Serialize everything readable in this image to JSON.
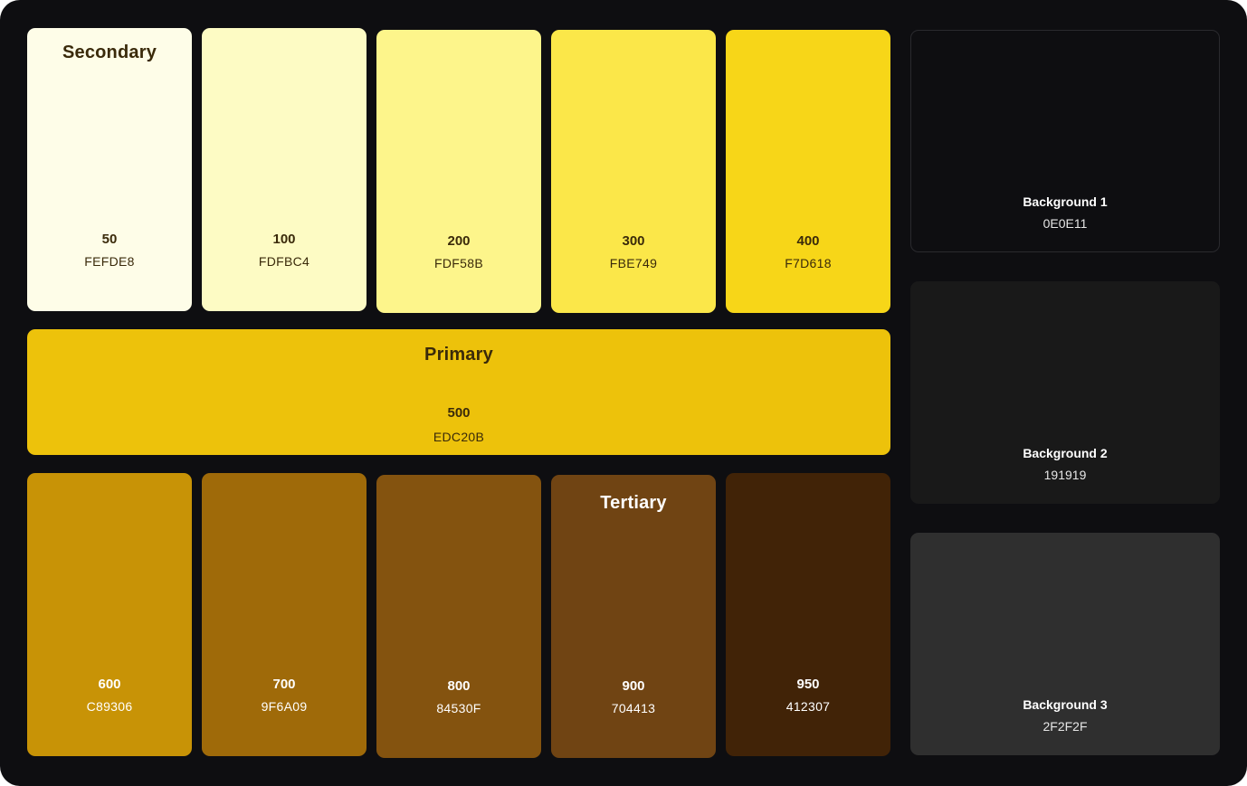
{
  "palette": {
    "secondary_title": "Secondary",
    "primary_title": "Primary",
    "tertiary_title": "Tertiary",
    "swatches": [
      {
        "shade": "50",
        "hex": "FEFDE8",
        "color": "#FEFDE8",
        "text_color": "#3a2a0a"
      },
      {
        "shade": "100",
        "hex": "FDFBC4",
        "color": "#FDFBC4",
        "text_color": "#3a2a0a"
      },
      {
        "shade": "200",
        "hex": "FDF58B",
        "color": "#FDF58B",
        "text_color": "#3a2a0a"
      },
      {
        "shade": "300",
        "hex": "FBE749",
        "color": "#FBE749",
        "text_color": "#3a2a0a"
      },
      {
        "shade": "400",
        "hex": "F7D618",
        "color": "#F7D618",
        "text_color": "#3a2a0a"
      },
      {
        "shade": "500",
        "hex": "EDC20B",
        "color": "#EDC20B",
        "text_color": "#3a2a0a"
      },
      {
        "shade": "600",
        "hex": "C89306",
        "color": "#C89306",
        "text_color": "#ffffff"
      },
      {
        "shade": "700",
        "hex": "9F6A09",
        "color": "#9F6A09",
        "text_color": "#ffffff"
      },
      {
        "shade": "800",
        "hex": "84530F",
        "color": "#84530F",
        "text_color": "#ffffff"
      },
      {
        "shade": "900",
        "hex": "704413",
        "color": "#704413",
        "text_color": "#ffffff"
      },
      {
        "shade": "950",
        "hex": "412307",
        "color": "#412307",
        "text_color": "#ffffff"
      }
    ]
  },
  "backgrounds": [
    {
      "name": "Background 1",
      "hex": "0E0E11",
      "color": "#0E0E11"
    },
    {
      "name": "Background 2",
      "hex": "191919",
      "color": "#191919"
    },
    {
      "name": "Background 3",
      "hex": "2F2F2F",
      "color": "#2F2F2F"
    }
  ]
}
